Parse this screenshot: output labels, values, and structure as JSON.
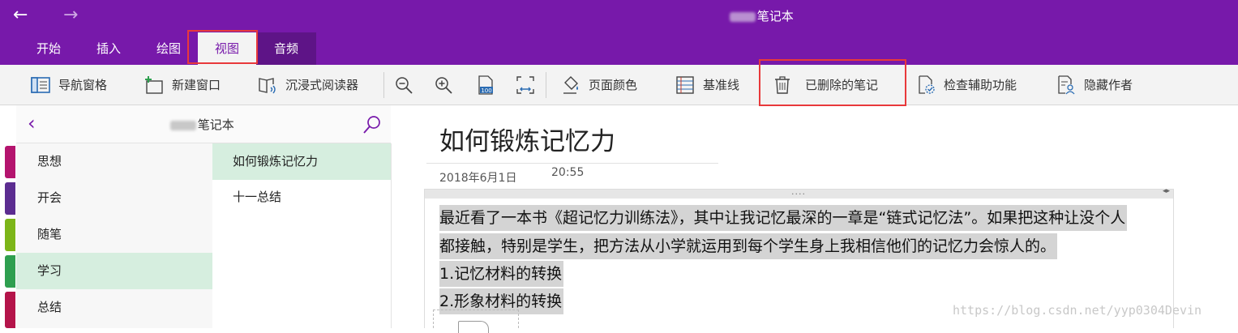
{
  "titlebar": {
    "back_icon": "arrow-left-icon",
    "forward_icon": "arrow-right-icon",
    "app_title_obscured": "███",
    "app_title": "笔记本"
  },
  "tabs": [
    "开始",
    "插入",
    "绘图",
    "视图",
    "音频"
  ],
  "toolbar": {
    "nav_pane": "导航窗格",
    "new_window": "新建窗口",
    "immersive_reader": "沉浸式阅读器",
    "page_color": "页面颜色",
    "rule_lines": "基准线",
    "deleted_notes": "已删除的笔记",
    "check_accessibility": "检查辅助功能",
    "hide_authors": "隐藏作者",
    "zoom_in_label": "100"
  },
  "notebook": {
    "title_obscured": "███",
    "title": "笔记本"
  },
  "sections": [
    {
      "label": "思想",
      "color": "#B4146E"
    },
    {
      "label": "开会",
      "color": "#5C2D91"
    },
    {
      "label": "随笔",
      "color": "#7CB518"
    },
    {
      "label": "学习",
      "color": "#2E9F4F"
    },
    {
      "label": "总结",
      "color": "#B4144A"
    }
  ],
  "pages": [
    "如何锻炼记忆力",
    "十一总结"
  ],
  "page": {
    "title": "如何锻炼记忆力",
    "date": "2018年6月1日",
    "time": "20:55",
    "lines": [
      "最近看了一本书《超记忆力训练法》，其中让我记忆最深的一章是“链式记忆法”。如果把这种让没个人",
      "都接触，特别是学生，把方法从小学就运用到每个学生身上我相信他们的记忆力会惊人的。",
      "1.记忆材料的转换",
      "2.形象材料的转换"
    ],
    "grip": "....",
    "resize": "◂▸"
  },
  "watermark": "https://blog.csdn.net/yyp0304Devin",
  "colors": {
    "brand": "#7719AA",
    "selected": "#D6EEDF",
    "highlight_box": "#E8393B"
  }
}
